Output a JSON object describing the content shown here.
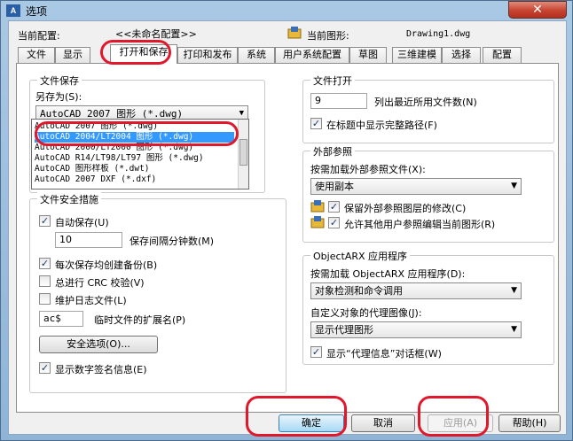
{
  "window": {
    "title": "选项",
    "app_icon": "autocad-icon",
    "close": "✕"
  },
  "header": {
    "current_profile_label": "当前配置:",
    "current_profile_value": "<<未命名配置>>",
    "current_drawing_label": "当前图形:",
    "current_drawing_value": "Drawing1.dwg"
  },
  "tabs": [
    "文件",
    "显示",
    "打开和保存",
    "打印和发布",
    "系统",
    "用户系统配置",
    "草图",
    "三维建模",
    "选择",
    "配置"
  ],
  "file_save": {
    "title": "文件保存",
    "save_as_label": "另存为(S):",
    "save_as_value": "AutoCAD 2007 图形 (*.dwg)",
    "options": [
      "AutoCAD 2007 图形 (*.dwg)",
      "AutoCAD 2004/LT2004 图形 (*.dwg)",
      "AutoCAD 2000/LT2000 图形 (*.dwg)",
      "AutoCAD R14/LT98/LT97 图形 (*.dwg)",
      "AutoCAD 图形样板 (*.dwt)",
      "AutoCAD 2007 DXF (*.dxf)"
    ],
    "selected_index": 1
  },
  "file_safety": {
    "title": "文件安全措施",
    "autosave_label": "自动保存(U)",
    "autosave_checked": true,
    "interval_value": "10",
    "interval_label": "保存间隔分钟数(M)",
    "backup_label": "每次保存均创建备份(B)",
    "backup_checked": true,
    "crc_label": "总进行 CRC 校验(V)",
    "crc_checked": false,
    "log_label": "维护日志文件(L)",
    "log_checked": false,
    "temp_ext_value": "ac$",
    "temp_ext_label": "临时文件的扩展名(P)",
    "security_button": "安全选项(O)...",
    "digital_sig_label": "显示数字签名信息(E)",
    "digital_sig_checked": true
  },
  "file_open": {
    "title": "文件打开",
    "recent_count_value": "9",
    "recent_count_label": "列出最近所用文件数(N)",
    "full_path_label": "在标题中显示完整路径(F)",
    "full_path_checked": true
  },
  "xref": {
    "title": "外部参照",
    "demand_load_label": "按需加载外部参照文件(X):",
    "demand_load_value": "使用副本",
    "retain_changes_label": "保留外部参照图层的修改(C)",
    "retain_changes_checked": true,
    "allow_edit_label": "允许其他用户参照编辑当前图形(R)",
    "allow_edit_checked": true
  },
  "objectarx": {
    "title": "ObjectARX 应用程序",
    "demand_load_label": "按需加载 ObjectARX 应用程序(D):",
    "demand_load_value": "对象检测和命令调用",
    "proxy_label": "自定义对象的代理图像(J):",
    "proxy_value": "显示代理图形",
    "proxy_info_label": "显示“代理信息”对话框(W)",
    "proxy_info_checked": true
  },
  "buttons": {
    "ok": "确定",
    "cancel": "取消",
    "apply": "应用(A)",
    "help": "帮助(H)"
  },
  "annotation_color": "#e0182c",
  "selection_color": "#3399ff"
}
